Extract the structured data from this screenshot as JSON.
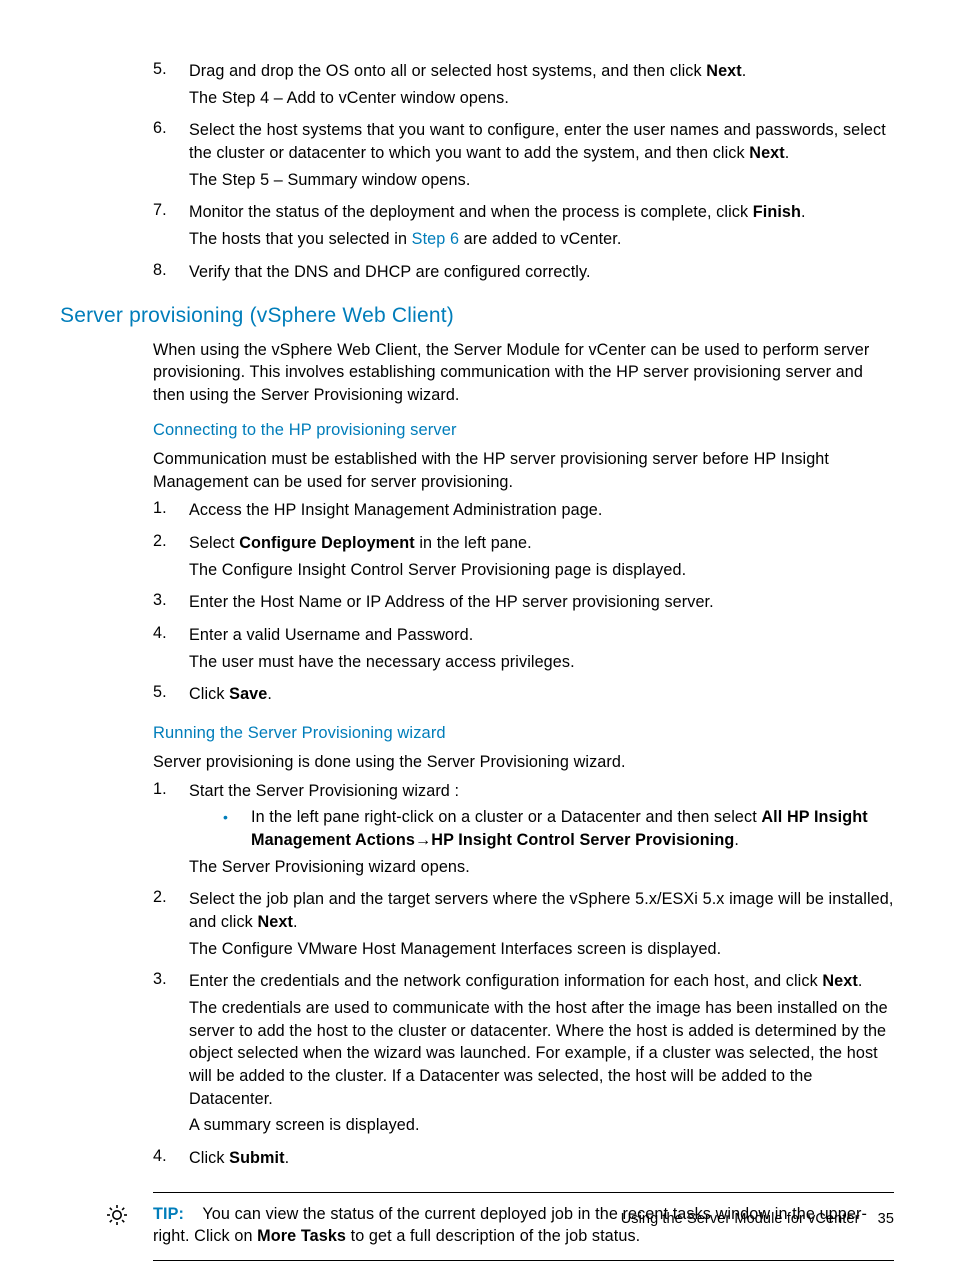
{
  "list1": {
    "i5": {
      "num": "5.",
      "text_a": "Drag and drop the OS onto all or selected host systems, and then click ",
      "text_b": "Next",
      "text_c": ".",
      "after": "The Step 4 – Add to vCenter window opens."
    },
    "i6": {
      "num": "6.",
      "text_a": "Select the host systems that you want to configure, enter the user names and passwords, select the cluster or datacenter to which you want to add the system, and then click ",
      "text_b": "Next",
      "text_c": ".",
      "after": "The Step 5 – Summary window opens."
    },
    "i7": {
      "num": "7.",
      "text_a": "Monitor the status of the deployment and when the process is complete, click ",
      "text_b": "Finish",
      "text_c": ".",
      "after_a": "The hosts that you selected in ",
      "after_link": "Step 6",
      "after_b": " are added to vCenter."
    },
    "i8": {
      "num": "8.",
      "text": "Verify that the DNS and DHCP are configured correctly."
    }
  },
  "h2": "Server provisioning (vSphere Web Client)",
  "intro": "When using the vSphere Web Client, the Server Module for vCenter can be used to perform server provisioning. This involves establishing communication with the HP server provisioning server and then using the Server Provisioning wizard.",
  "sec_a": {
    "title": "Connecting to the HP provisioning server",
    "intro": "Communication must be established with the HP server provisioning server before HP Insight Management can be used for server provisioning.",
    "steps": {
      "s1": {
        "num": "1.",
        "text": "Access the HP Insight Management Administration page."
      },
      "s2": {
        "num": "2.",
        "a": "Select ",
        "b": "Configure Deployment",
        "c": " in the left pane.",
        "after": "The Configure Insight Control Server Provisioning page is displayed."
      },
      "s3": {
        "num": "3.",
        "text": "Enter the Host Name or IP Address of the HP server provisioning server."
      },
      "s4": {
        "num": "4.",
        "text": "Enter a valid Username and Password.",
        "after": "The user must have the necessary access privileges."
      },
      "s5": {
        "num": "5.",
        "a": "Click ",
        "b": "Save",
        "c": "."
      }
    }
  },
  "sec_b": {
    "title": "Running the Server Provisioning wizard",
    "intro": "Server provisioning is done using the Server Provisioning wizard.",
    "steps": {
      "s1": {
        "num": "1.",
        "text": "Start the Server Provisioning wizard :",
        "bullet_a": "In the left pane right-click on a cluster or a Datacenter and then select ",
        "bullet_b": "All HP Insight Management Actions",
        "bullet_arrow": "→",
        "bullet_c": "HP Insight Control Server Provisioning",
        "bullet_d": ".",
        "after": "The Server Provisioning wizard opens."
      },
      "s2": {
        "num": "2.",
        "a": "Select the job plan and the target servers where the vSphere 5.x/ESXi 5.x image will be installed, and click ",
        "b": "Next",
        "c": ".",
        "after": "The Configure VMware Host Management Interfaces screen is displayed."
      },
      "s3": {
        "num": "3.",
        "a": "Enter the credentials and the network configuration information for each host, and click ",
        "b": "Next",
        "c": ".",
        "after1": "The credentials are used to communicate with the host after the image has been installed on the server to add the host to the cluster or datacenter. Where the host is added is determined by the object selected when the wizard was launched. For example, if a cluster was selected, the host will be added to the cluster. If a Datacenter was selected, the host will be added to the Datacenter.",
        "after2": "A summary screen is displayed."
      },
      "s4": {
        "num": "4.",
        "a": "Click ",
        "b": "Submit",
        "c": "."
      }
    }
  },
  "tip": {
    "label": "TIP:",
    "a": "You can view the status of the current deployed job in the recent tasks window in the upper-right. Click on ",
    "b": "More Tasks",
    "c": " to get a full description of the job status."
  },
  "footer": {
    "text": "Using the Server Module for vCenter",
    "page": "35"
  }
}
